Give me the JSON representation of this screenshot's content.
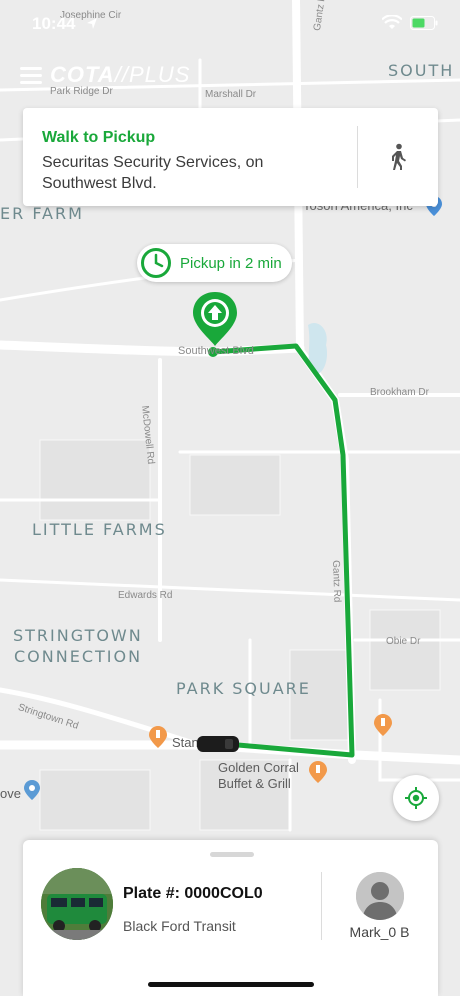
{
  "status_bar": {
    "time": "10:44"
  },
  "header": {
    "logo_main": "COTA",
    "logo_slash": "//",
    "logo_sub": "PLUS"
  },
  "pickup_card": {
    "title": "Walk to Pickup",
    "address": "Securitas Security Services, on Southwest Blvd.",
    "walk_icon": "walking-person-icon"
  },
  "pickup_bubble": {
    "text": "Pickup in 2 min",
    "icon": "clock-icon"
  },
  "map": {
    "areas": [
      "LITTLE FARMS",
      "STRINGTOWN",
      "CONNECTION",
      "PARK SQUARE",
      "ER FARM",
      "SOUTH"
    ],
    "roads": [
      "Southwest Blvd",
      "Brookham Dr",
      "McDowell Rd",
      "Gantz Rd",
      "Edwards Rd",
      "Obie Dr",
      "Stringtown Rd",
      "Gantz Rd",
      "Stanley",
      "Josephine Cir",
      "Park Ridge Dr",
      "Marshall Dr"
    ],
    "pois": [
      "Golden Corral",
      "Buffet & Grill",
      "Tosoh America, Inc",
      "ove"
    ],
    "route_color": "#19a83a"
  },
  "vehicle": {
    "plate": "Plate #: 0000COL0",
    "description": "Black Ford Transit"
  },
  "driver": {
    "name": "Mark_0 B"
  },
  "colors": {
    "accent": "#19a83a",
    "card_bg": "#ffffff",
    "map_bg": "#ececec"
  }
}
